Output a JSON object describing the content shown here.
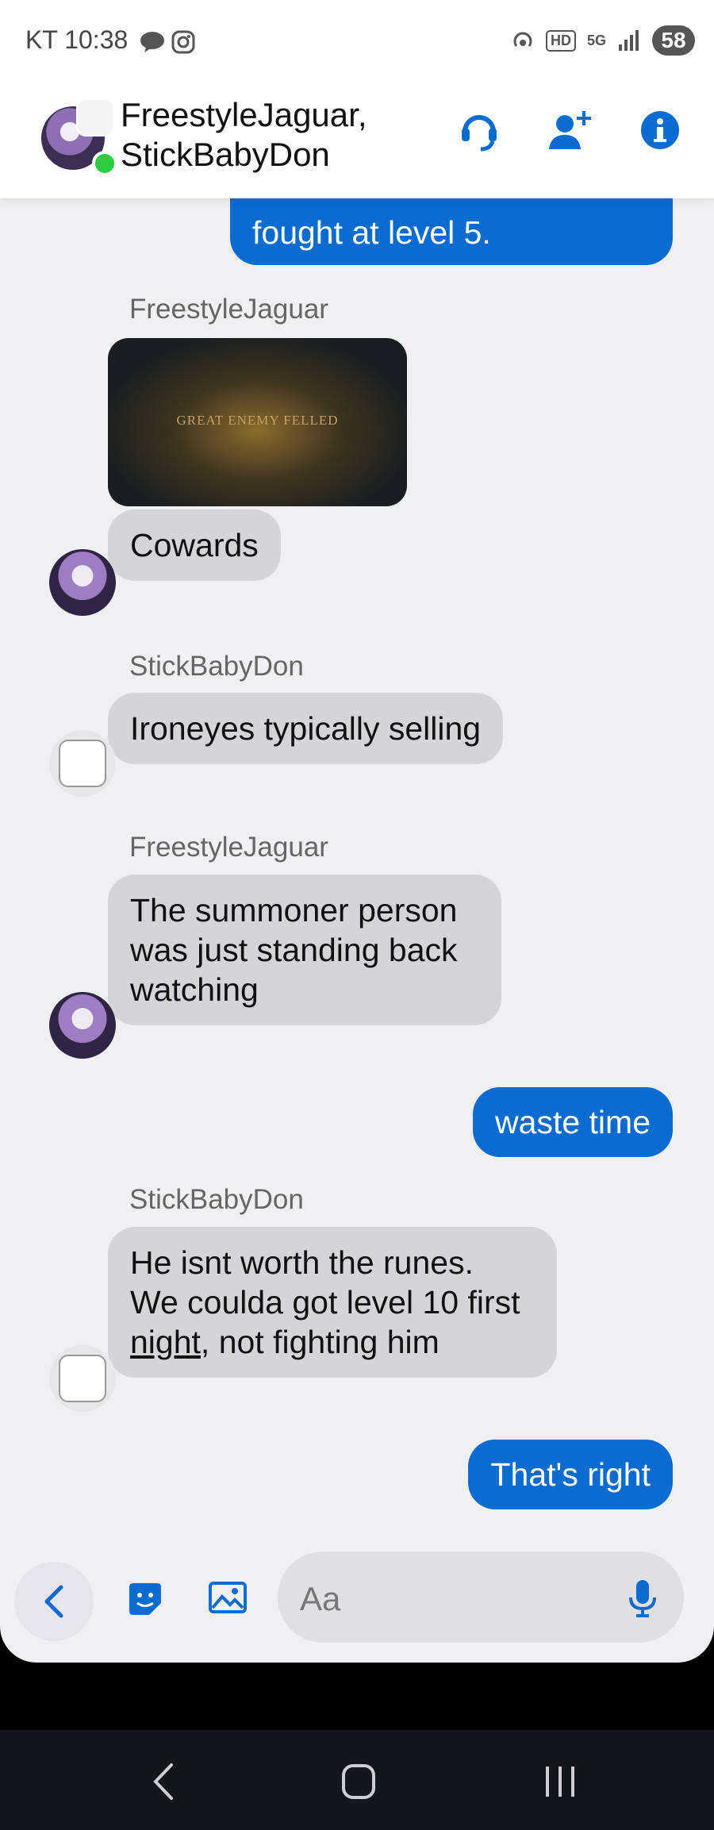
{
  "status_bar": {
    "carrier": "KT",
    "time": "10:38",
    "battery": "58",
    "network": "5G",
    "hd_label": "HD"
  },
  "header": {
    "title_line1": "FreestyleJaguar,",
    "title_line2": "StickBabyDon"
  },
  "messages": {
    "partial_out": "fought at level 5.",
    "sender1": "FreestyleJaguar",
    "image_caption": "GREAT ENEMY FELLED",
    "msg_cowards": "Cowards",
    "sender2": "StickBabyDon",
    "msg_ironeyes": "Ironeyes typically selling",
    "sender3": "FreestyleJaguar",
    "msg_summoner": "The summoner person was just standing back watching",
    "msg_waste": "waste time",
    "sender4": "StickBabyDon",
    "msg_runes_1": "He isnt worth the runes.",
    "msg_runes_2": "We coulda got level 10 first",
    "msg_runes_night": "night",
    "msg_runes_3": ", not fighting him",
    "msg_right": "That's right"
  },
  "composer": {
    "placeholder": "Aa"
  },
  "colors": {
    "accent": "#0a6bd1",
    "incoming_bubble": "#d5d5d8",
    "background": "#f0f0f2",
    "online": "#2ecc40"
  },
  "icons": [
    "message-icon",
    "instagram-icon",
    "hotspot-icon",
    "signal-icon",
    "call-icon",
    "add-person-icon",
    "info-icon",
    "back-icon",
    "sticker-icon",
    "gallery-icon",
    "mic-icon",
    "nav-back-icon",
    "nav-home-icon",
    "nav-recents-icon"
  ]
}
